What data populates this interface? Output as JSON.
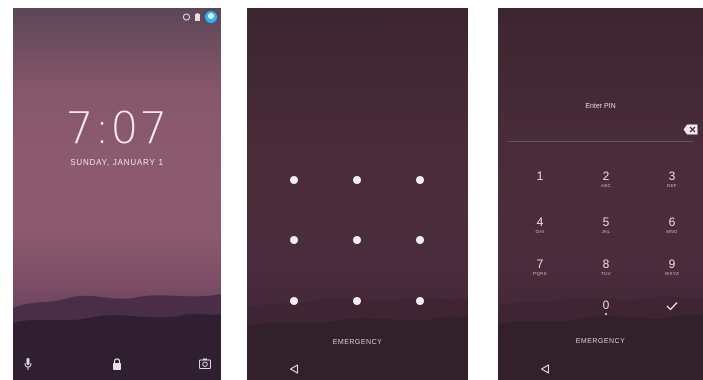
{
  "lock_screen": {
    "time": "7:07",
    "date": "SUNDAY, JANUARY 1",
    "status_icons": [
      "notification-icon",
      "battery-icon",
      "user-avatar-icon"
    ],
    "bottom_icons": [
      "microphone-icon",
      "lock-icon",
      "camera-icon"
    ]
  },
  "pattern_screen": {
    "dot_rows": 3,
    "dot_cols": 3,
    "emergency_label": "EMERGENCY",
    "nav_icon": "back-icon"
  },
  "pin_screen": {
    "title": "Enter PIN",
    "delete_icon": "backspace-icon",
    "keys": [
      {
        "digit": "1",
        "letters": ""
      },
      {
        "digit": "2",
        "letters": "ABC"
      },
      {
        "digit": "3",
        "letters": "DEF"
      },
      {
        "digit": "4",
        "letters": "GHI"
      },
      {
        "digit": "5",
        "letters": "JKL"
      },
      {
        "digit": "6",
        "letters": "MNO"
      },
      {
        "digit": "7",
        "letters": "PQRS"
      },
      {
        "digit": "8",
        "letters": "TUV"
      },
      {
        "digit": "9",
        "letters": "WXYZ"
      },
      {
        "digit": "0",
        "letters": ""
      }
    ],
    "enter_icon": "checkmark-icon",
    "emergency_label": "EMERGENCY",
    "nav_icon": "back-icon"
  },
  "colors": {
    "lock_gradient_mid": "#8d5b70",
    "dark_panel": "#4a2c3c",
    "avatar_accent": "#29b6f6"
  }
}
